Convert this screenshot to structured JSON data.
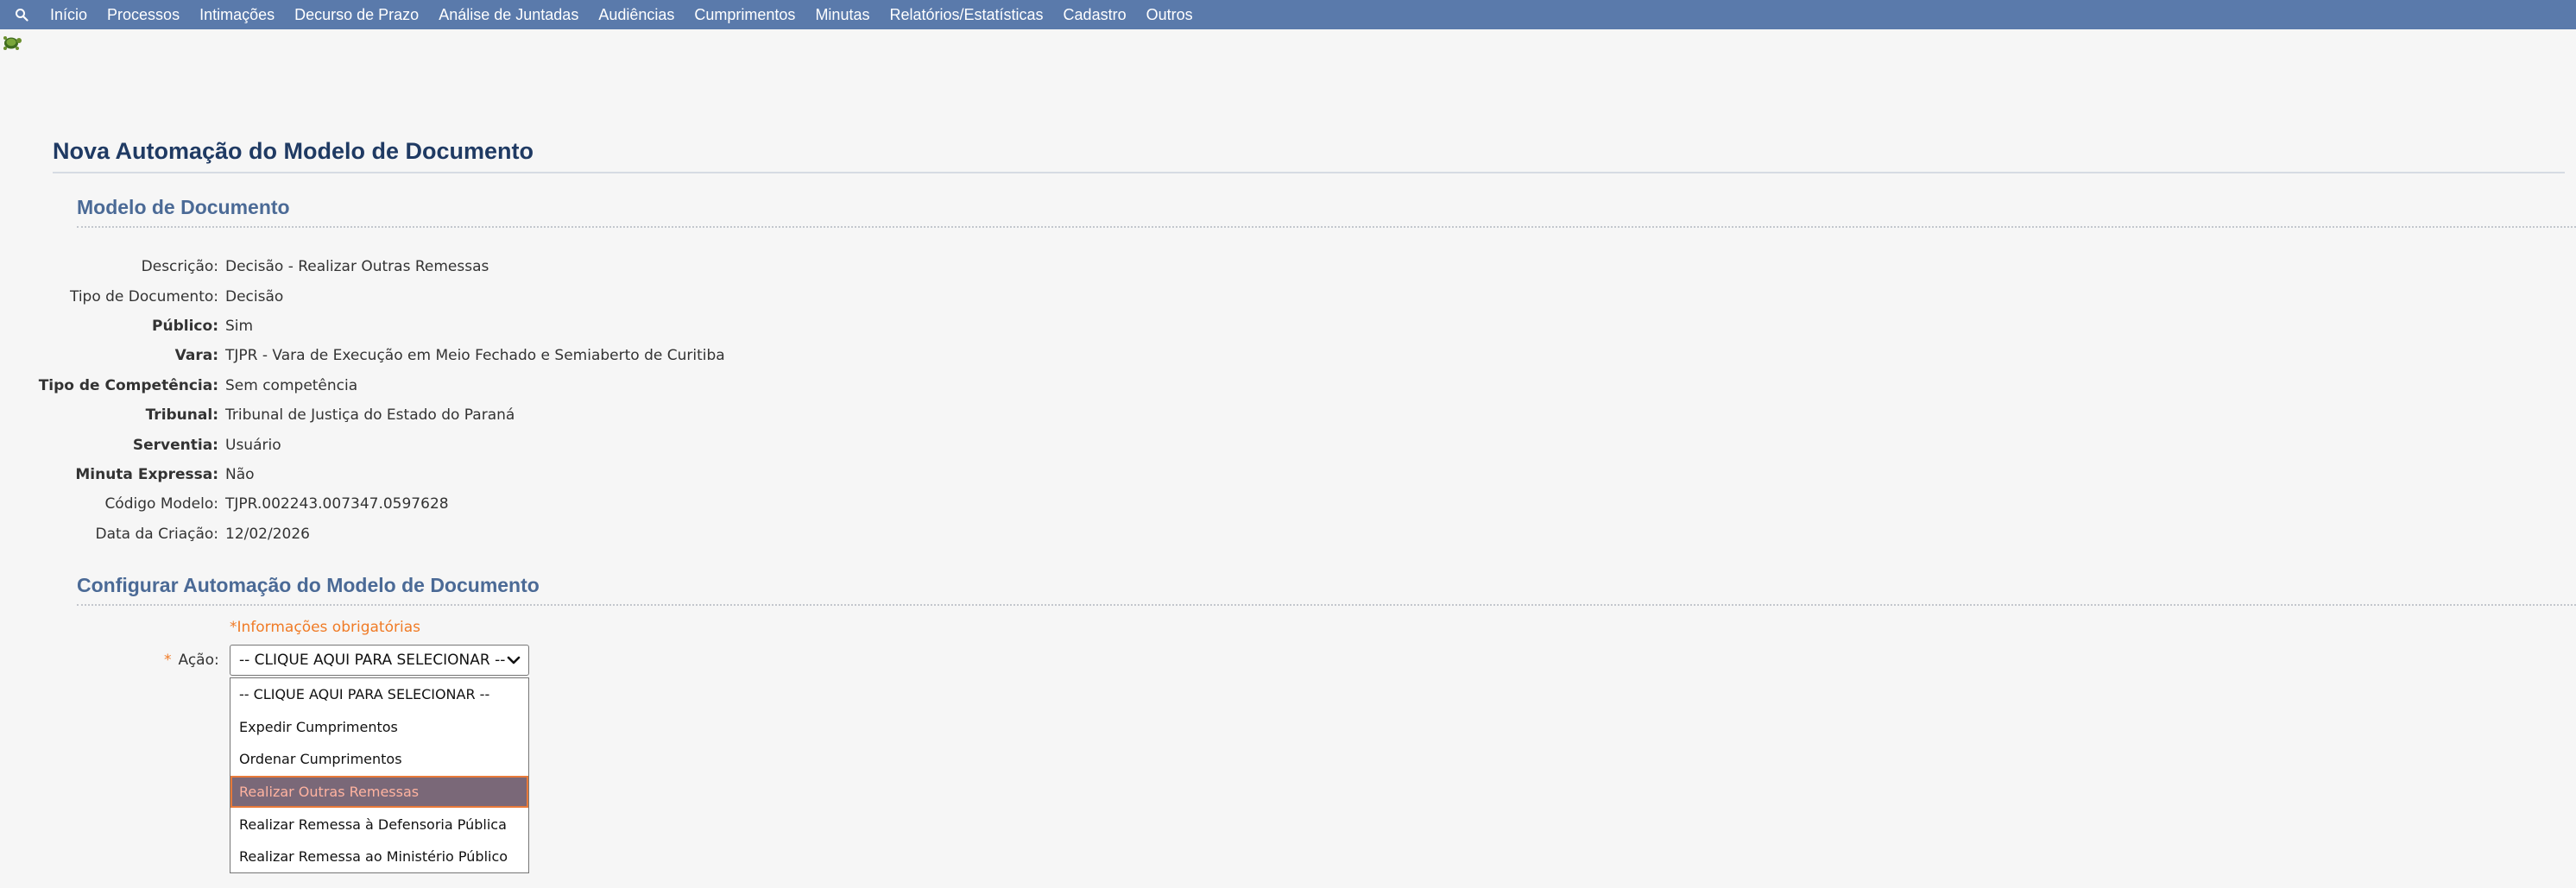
{
  "menu": {
    "items": [
      "Início",
      "Processos",
      "Intimações",
      "Decurso de Prazo",
      "Análise de Juntadas",
      "Audiências",
      "Cumprimentos",
      "Minutas",
      "Relatórios/Estatísticas",
      "Cadastro",
      "Outros"
    ]
  },
  "page": {
    "title": "Nova Automação do Modelo de Documento"
  },
  "modelo": {
    "section_title": "Modelo de Documento",
    "fields": [
      {
        "label": "Descrição:",
        "value": "Decisão - Realizar Outras Remessas",
        "bold": false
      },
      {
        "label": "Tipo de Documento:",
        "value": "Decisão",
        "bold": false
      },
      {
        "label": "Público:",
        "value": "Sim",
        "bold": true
      },
      {
        "label": "Vara:",
        "value": "TJPR - Vara de Execução em Meio Fechado e Semiaberto de Curitiba",
        "bold": true
      },
      {
        "label": "Tipo de Competência:",
        "value": "Sem competência",
        "bold": true
      },
      {
        "label": "Tribunal:",
        "value": "Tribunal de Justiça do Estado do Paraná",
        "bold": true
      },
      {
        "label": "Serventia:",
        "value": "Usuário",
        "bold": true
      },
      {
        "label": "Minuta Expressa:",
        "value": "Não",
        "bold": true
      },
      {
        "label": "Código Modelo:",
        "value": "TJPR.002243.007347.0597628",
        "bold": false
      },
      {
        "label": "Data da Criação:",
        "value": "12/02/2026",
        "bold": false
      }
    ]
  },
  "config": {
    "section_title": "Configurar Automação do Modelo de Documento",
    "required_note": "*Informações obrigatórias",
    "acao_star": "*",
    "acao_label": "Ação:",
    "select_value": "-- CLIQUE AQUI PARA SELECIONAR --",
    "options": [
      {
        "label": "-- CLIQUE AQUI PARA SELECIONAR --",
        "selected": false
      },
      {
        "label": "Expedir Cumprimentos",
        "selected": false
      },
      {
        "label": "Ordenar Cumprimentos",
        "selected": false
      },
      {
        "label": "Realizar Outras Remessas",
        "selected": true
      },
      {
        "label": "Realizar Remessa à Defensoria Pública",
        "selected": false
      },
      {
        "label": "Realizar Remessa ao Ministério Público",
        "selected": false
      }
    ]
  },
  "colors": {
    "topbar": "#5a7aab",
    "title": "#1f3a63",
    "section": "#4b6a96",
    "required": "#f07b26",
    "highlight_bg": "#7a6878"
  },
  "icons": [
    "search-icon",
    "turtle-icon",
    "chevron-down-icon"
  ]
}
